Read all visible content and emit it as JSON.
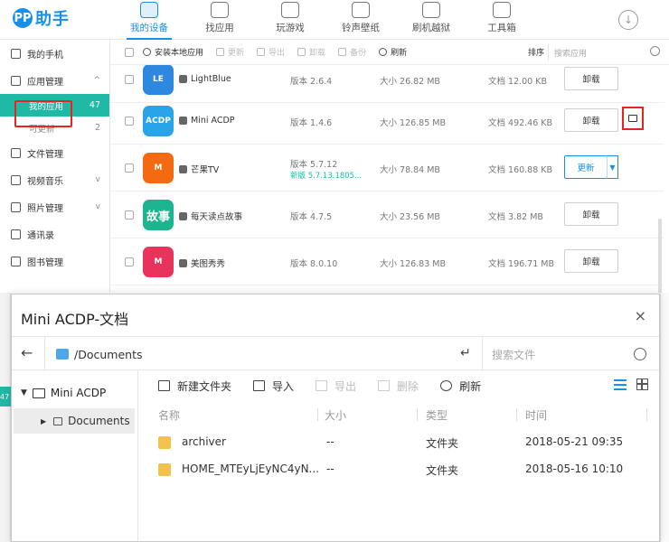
{
  "app": {
    "logo_badge": "PP",
    "logo_text": "助手",
    "nav": [
      {
        "label": "我的设备",
        "icon": "phone-icon",
        "active": true
      },
      {
        "label": "找应用",
        "icon": "bag-icon"
      },
      {
        "label": "玩游戏",
        "icon": "gamepad-icon"
      },
      {
        "label": "铃声壁纸",
        "icon": "bell-icon"
      },
      {
        "label": "刷机越狱",
        "icon": "refresh-icon"
      },
      {
        "label": "工具箱",
        "icon": "toolbox-icon"
      }
    ],
    "download_icon": "↓"
  },
  "sidebar": {
    "items": [
      {
        "label": "我的手机"
      },
      {
        "label": "应用管理",
        "chevron": "^"
      },
      {
        "label": "我的应用",
        "count": "47",
        "sub": true,
        "selected": true
      },
      {
        "label": "可更新",
        "count": "2",
        "sub": true
      },
      {
        "label": "文件管理"
      },
      {
        "label": "视频音乐",
        "chevron": "v"
      },
      {
        "label": "照片管理",
        "chevron": "v"
      },
      {
        "label": "通讯录"
      },
      {
        "label": "图书管理"
      }
    ]
  },
  "toolbar": {
    "install": "安装本地应用",
    "update": "更新",
    "export": "导出",
    "uninstall": "卸载",
    "backup": "备份",
    "refresh": "刷新",
    "sort": "排序",
    "search_placeholder": "搜索应用"
  },
  "apps": [
    {
      "name": "LightBlue",
      "icon_text": "LE",
      "version": "版本 2.6.4",
      "size": "大小 26.82 MB",
      "docs": "文档 12.00 KB",
      "button": "卸载"
    },
    {
      "name": "Mini ACDP",
      "icon_text": "ACDP",
      "version": "版本 1.4.6",
      "size": "大小 126.85 MB",
      "docs": "文档 492.46 KB",
      "button": "卸载"
    },
    {
      "name": "芒果TV",
      "icon_text": "M",
      "version": "版本 5.7.12",
      "new_version": "新版 5.7.13.1805...",
      "size": "大小 78.84 MB",
      "docs": "文档 160.88 KB",
      "button": "更新"
    },
    {
      "name": "每天读点故事",
      "icon_text": "故事",
      "version": "版本 4.7.5",
      "size": "大小 23.56 MB",
      "docs": "文档 3.82 MB",
      "button": "卸载"
    },
    {
      "name": "美图秀秀",
      "icon_text": "M",
      "version": "版本 8.0.10",
      "size": "大小 126.83 MB",
      "docs": "文档 196.71 MB",
      "button": "卸载"
    }
  ],
  "behind": {
    "count": "47"
  },
  "dialog": {
    "title": "Mini ACDP-文档",
    "close": "×",
    "back": "←",
    "enter": "↵",
    "path": "/Documents",
    "search_placeholder": "搜索文件",
    "tree": {
      "root": "Mini ACDP",
      "child": "Documents"
    },
    "toolbar": {
      "new_folder": "新建文件夹",
      "import": "导入",
      "export": "导出",
      "delete": "删除",
      "refresh": "刷新"
    },
    "columns": {
      "name": "名称",
      "size": "大小",
      "type": "类型",
      "time": "时间"
    },
    "files": [
      {
        "name": "archiver",
        "size": "--",
        "type": "文件夹",
        "time": "2018-05-21 09:35"
      },
      {
        "name": "HOME_MTEyLjEyNC4yN...",
        "size": "--",
        "type": "文件夹",
        "time": "2018-05-16 10:10"
      }
    ]
  },
  "colors": {
    "brand": "#1a8fe6",
    "selected": "#20b9a5",
    "highlight": "#e8251c"
  }
}
